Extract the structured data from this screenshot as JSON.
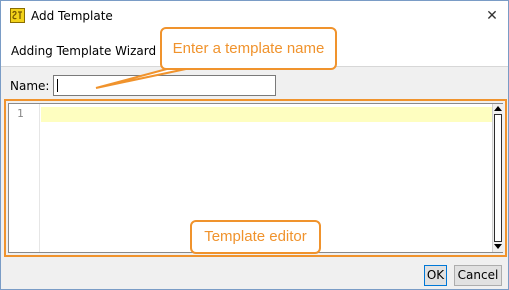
{
  "window": {
    "title": "Add Template",
    "wizard_heading": "Adding Template Wizard"
  },
  "form": {
    "name_label": "Name:",
    "name_value": ""
  },
  "editor": {
    "line_numbers": [
      "1"
    ]
  },
  "buttons": {
    "ok_label": "OK",
    "cancel_label": "Cancel"
  },
  "callouts": {
    "name_hint": "Enter a template name",
    "editor_hint": "Template editor"
  },
  "colors": {
    "callout_accent": "#f0932d",
    "current_line_highlight": "#fefec0"
  }
}
